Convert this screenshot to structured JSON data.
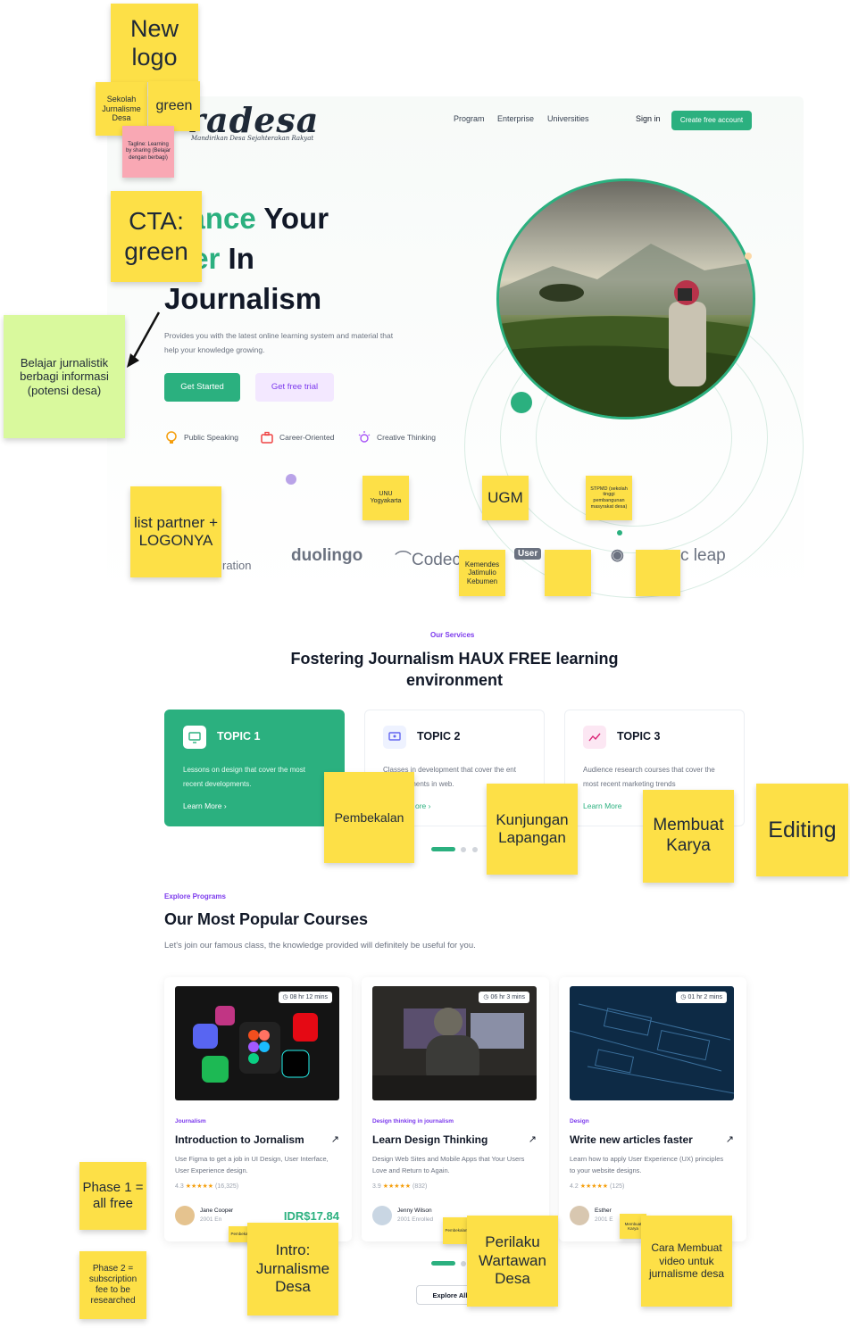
{
  "brand": {
    "logo_text": "radesa",
    "tagline": "Mandirikan Desa Sejahterakan Rakyat"
  },
  "nav": {
    "items": [
      "Program",
      "Enterprise",
      "Universities"
    ],
    "signin": "Sign in",
    "cta": "Create free account"
  },
  "hero": {
    "title_green_1": "lvance",
    "title_black_1": " Your",
    "title_green_2": "reer",
    "title_black_2": " In",
    "title_line_3": "Journalism",
    "description": "Provides you with the latest online learning system and material that help your knowledge growing.",
    "btn_primary": "Get Started",
    "btn_secondary": "Get free trial",
    "features": [
      "Public Speaking",
      "Career-Oriented",
      "Creative Thinking"
    ]
  },
  "partners": {
    "items": [
      "ration",
      "duolingo",
      "Codec",
      "User",
      "c leap"
    ]
  },
  "services": {
    "kicker": "Our Services",
    "title": "Fostering Journalism HAUX FREE learning environment",
    "topics": [
      {
        "title": "TOPIC 1",
        "desc": "Lessons on design that cover the most recent developments.",
        "more": "Learn More  ›"
      },
      {
        "title": "TOPIC 2",
        "desc": "Classes in development that cover the ent advancements in web.",
        "more": "ore  ›"
      },
      {
        "title": "TOPIC 3",
        "desc": "Audience research courses that cover the most recent marketing trends",
        "more": "Learn More"
      }
    ]
  },
  "courses": {
    "kicker": "Explore Programs",
    "title": "Our Most Popular Courses",
    "subtitle": "Let's join our famous class, the knowledge provided will definitely be useful for you.",
    "items": [
      {
        "time": "08 hr 12 mins",
        "tag": "Journalism",
        "title": "Introduction to Jornalism",
        "desc": "Use Figma to get a job in UI Design, User Interface, User Experience design.",
        "rating": "4.3",
        "reviews": "(16,325)",
        "instructor": "Jane Cooper",
        "enrolled": "2001 En",
        "price": "IDR$17.84"
      },
      {
        "time": "06 hr 3 mins",
        "tag": "Design thinking in journalism",
        "title": "Learn Design Thinking",
        "desc": "Design Web Sites and Mobile Apps that Your Users Love and Return to Again.",
        "rating": "3.9",
        "reviews": "(832)",
        "instructor": "Jenny Wilson",
        "enrolled": "2001 Enrolled",
        "price": ""
      },
      {
        "time": "01 hr 2 mins",
        "tag": "Design",
        "title": "Write new articles faster",
        "desc": "Learn how to apply User Experience (UX) principles to your website designs.",
        "rating": "4.2",
        "reviews": "(125)",
        "instructor": "Esther",
        "enrolled": "2001 E",
        "price": ""
      }
    ],
    "explore_btn": "Explore All Co"
  },
  "notes": {
    "new_logo": "New logo",
    "sekolah": "Sekolah Jurnalisme Desa",
    "green_logo": "green",
    "tagline": "Tagline: Learning by sharing (Belajar dengan berbagi)",
    "cta_green": "CTA: green",
    "belajar": "Belajar jurnalistik berbagi informasi (potensi desa)",
    "partners": "list partner + LOGONYA",
    "unu": "UNU Yogyakarta",
    "ugm": "UGM",
    "stpmd": "STPMD (sekolah tinggi pembangunan masyrakat desa)",
    "kemendes": "Kemendes Jatimulio Kebumen",
    "pembekalan": "Pembekalan",
    "kunjungan": "Kunjungan Lapangan",
    "membuat_karya": "Membuat Karya",
    "editing": "Editing",
    "phase1": "Phase 1 = all free",
    "phase2": "Phase 2 = subscription fee to be researched",
    "pembekalan_small": "Pembekalan",
    "intro": "Intro: Jurnalisme Desa",
    "pembekalan_small2": "Pembekalan",
    "perilaku": "Perilaku Wartawan Desa",
    "membuat_small": "Membuat Karya",
    "cara": "Cara Membuat video untuk jurnalisme desa"
  },
  "colors": {
    "accent": "#2bb07f",
    "purple": "#7c3aed",
    "sticky": "#fde047"
  }
}
